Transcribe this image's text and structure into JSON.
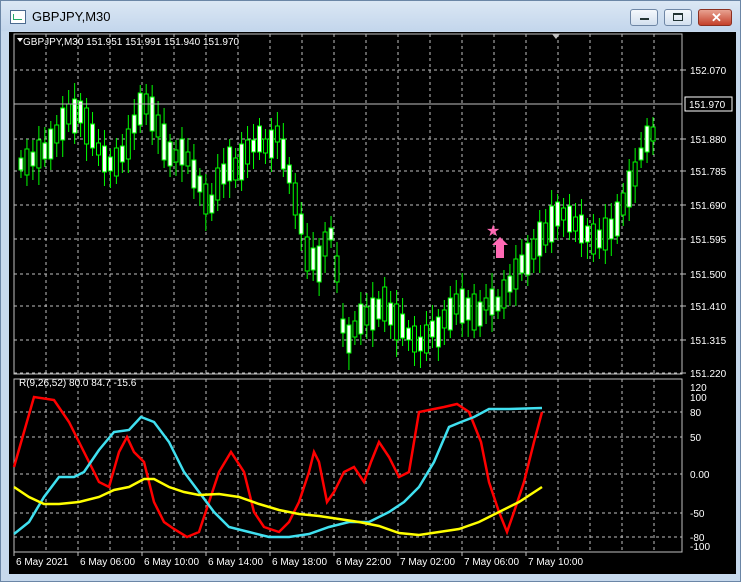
{
  "window": {
    "title": "GBPJPY,M30"
  },
  "main_chart": {
    "header": "GBPJPY,M30  151.951 151.991 151.940 151.970",
    "price_labels": [
      "152.070",
      "151.880",
      "151.785",
      "151.690",
      "151.595",
      "151.500",
      "151.410",
      "151.315",
      "151.220"
    ],
    "current_price": "151.970",
    "current_price_value": 151.97
  },
  "indicator": {
    "header": "R(9,26,52) 80.0 84.7 -15.6",
    "scale_labels": [
      "120",
      "100",
      "80",
      "50",
      "0.00",
      "-50",
      "-80",
      "-100"
    ]
  },
  "time_labels": [
    "6 May 2021",
    "6 May 06:00",
    "6 May 10:00",
    "6 May 14:00",
    "6 May 18:00",
    "6 May 22:00",
    "7 May 02:00",
    "7 May 06:00",
    "7 May 10:00"
  ],
  "colors": {
    "background": "#000000",
    "grid": "#c0c0c0",
    "bull": "#ffffff",
    "bear": "#000000",
    "wick": "#00ff00",
    "red": "#ff0000",
    "cyan": "#40e0f0",
    "yellow": "#ffff00",
    "marker": "#ff69b4"
  },
  "markers": [
    "star-icon",
    "arrow-up-icon"
  ]
}
